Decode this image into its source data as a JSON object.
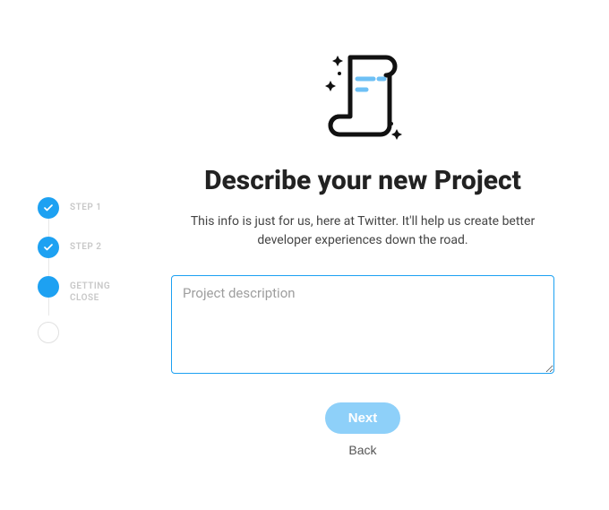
{
  "sidebar": {
    "steps": [
      {
        "label": "STEP 1",
        "state": "done"
      },
      {
        "label": "STEP 2",
        "state": "done"
      },
      {
        "label": "GETTING CLOSE",
        "state": "active"
      },
      {
        "label": "",
        "state": "pending"
      }
    ]
  },
  "main": {
    "title": "Describe your new Project",
    "subtitle": "This info is just for us, here at Twitter. It'll help us create better developer experiences down the road.",
    "description_placeholder": "Project description",
    "description_value": ""
  },
  "buttons": {
    "next": "Next",
    "back": "Back"
  }
}
